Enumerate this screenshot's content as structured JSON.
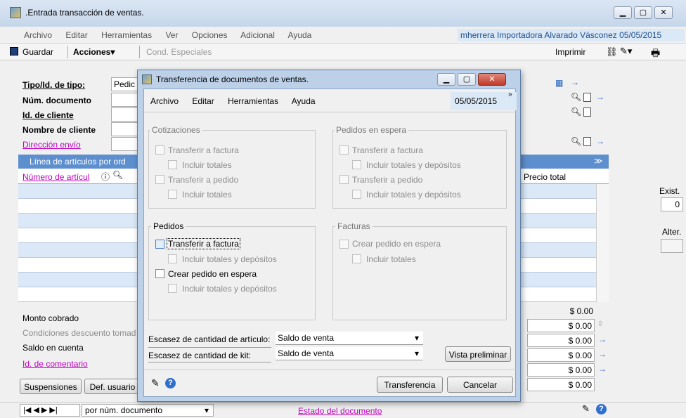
{
  "window": {
    "title": ".Entrada transacción de ventas.",
    "menu": [
      "Archivo",
      "Editar",
      "Herramientas",
      "Ver",
      "Opciones",
      "Adicional",
      "Ayuda"
    ],
    "user_info": "mherrera  Importadora Alvarado Vásconez  05/05/2015"
  },
  "toolbar": {
    "save": "Guardar",
    "actions": "Acciones",
    "special": "Cond. Especiales",
    "print": "Imprimir"
  },
  "form": {
    "tipo_label": "Tipo/Id. de tipo:",
    "tipo_value": "Pedic",
    "num_doc": "Núm. documento",
    "id_cliente": "Id. de cliente",
    "nombre_cliente": "Nombre de cliente",
    "direccion": "Dirección envío",
    "linea_header": "Línea de artículos por ord",
    "numero_articulo": "Número de artícul",
    "precio_total": "Precio total",
    "exist_label": "Exist.",
    "exist_value": "0",
    "alter_label": "Alter.",
    "monto": "Monto cobrado",
    "condiciones": "Condiciones descuento tomad",
    "saldo": "Saldo en cuenta",
    "id_comentario": "Id. de comentario",
    "suspensiones": "Suspensiones",
    "def_usuario": "Def. usuario",
    "amounts": [
      "$ 0.00",
      "$ 0.00",
      "$ 0.00",
      "$ 0.00",
      "$ 0.00",
      "$ 0.00"
    ]
  },
  "bottombar": {
    "sort": "por núm. documento",
    "estado": "Estado del documento"
  },
  "dialog": {
    "title": "Transferencia de documentos de ventas.",
    "menu": [
      "Archivo",
      "Editar",
      "Herramientas",
      "Ayuda"
    ],
    "date": "05/05/2015",
    "cotizaciones": {
      "title": "Cotizaciones",
      "t_factura": "Transferir a factura",
      "inc_totales1": "Incluir totales",
      "t_pedido": "Transferir a pedido",
      "inc_totales2": "Incluir totales"
    },
    "espera": {
      "title": "Pedidos en espera",
      "t_factura": "Transferir a factura",
      "inc1": "Incluir totales y depósitos",
      "t_pedido": "Transferir a pedido",
      "inc2": "Incluir totales y depósitos"
    },
    "pedidos": {
      "title": "Pedidos",
      "t_factura": "Transferir a factura",
      "inc1": "Incluir totales y depósitos",
      "crear": "Crear pedido en espera",
      "inc2": "Incluir totales y depósitos"
    },
    "facturas": {
      "title": "Facturas",
      "crear": "Crear pedido en espera",
      "inc": "Incluir totales"
    },
    "escasez_articulo_label": "Escasez de cantidad de artículo:",
    "escasez_articulo_value": "Saldo de venta",
    "escasez_kit_label": "Escasez de cantidad de kit:",
    "escasez_kit_value": "Saldo de venta",
    "vista": "Vista preliminar",
    "transferencia": "Transferencia",
    "cancelar": "Cancelar"
  }
}
